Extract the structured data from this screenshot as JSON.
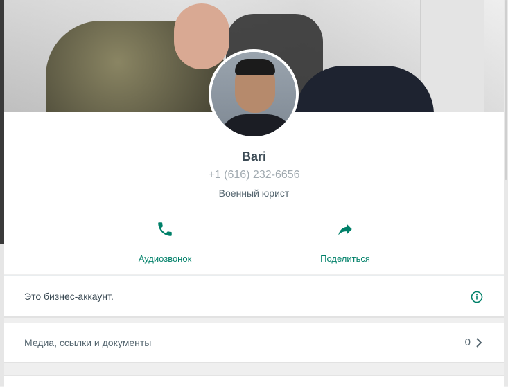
{
  "profile": {
    "name": "Bari",
    "phone": "+1 (616) 232-6656",
    "about": "Военный юрист"
  },
  "actions": {
    "call": {
      "label": "Аудиозвонок",
      "icon": "phone-icon"
    },
    "share": {
      "label": "Поделиться",
      "icon": "share-arrow-icon"
    }
  },
  "business": {
    "text": "Это бизнес-аккаунт.",
    "icon": "info-icon"
  },
  "media": {
    "label": "Медиа, ссылки и документы",
    "count": "0",
    "icon": "chevron-right-icon"
  },
  "colors": {
    "accent": "#008069",
    "title": "#3b4a54",
    "muted": "#a1aab0",
    "background": "#efefef"
  }
}
